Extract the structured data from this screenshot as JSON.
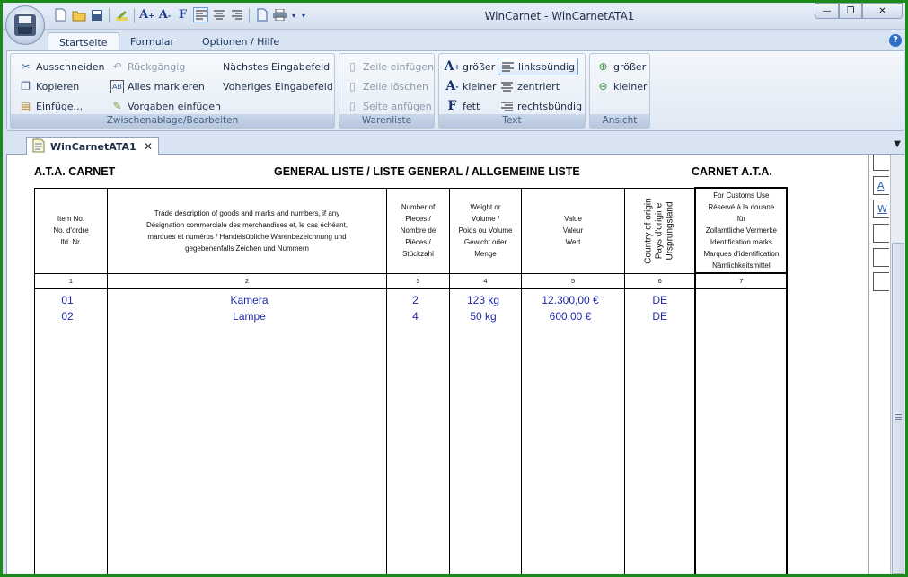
{
  "window": {
    "title": "WinCarnet - WinCarnetATA1",
    "controls": [
      "—",
      "❐",
      "✕"
    ]
  },
  "tabs": [
    "Startseite",
    "Formular",
    "Optionen / Hilfe"
  ],
  "ribbon": {
    "groups": {
      "clipboard": {
        "label": "Zwischenablage/Bearbeiten",
        "cut": "Ausschneiden",
        "copy": "Kopieren",
        "paste": "Einfüge...",
        "undo": "Rückgängig",
        "select_all": "Alles markieren",
        "defaults": "Vorgaben einfügen",
        "next_field": "Nächstes Eingabefeld",
        "prev_field": "Voheriges Eingabefeld"
      },
      "goods": {
        "label": "Warenliste",
        "insert_row": "Zeile einfügen",
        "delete_row": "Zeile löschen",
        "append_page": "Seite anfügen"
      },
      "text": {
        "label": "Text",
        "bigger": "größer",
        "smaller": "kleiner",
        "bold": "fett",
        "left": "linksbündig",
        "center": "zentriert",
        "right": "rechtsbündig"
      },
      "view": {
        "label": "Ansicht",
        "bigger": "größer",
        "smaller": "kleiner"
      }
    }
  },
  "document_tab": {
    "label": "WinCarnetATA1",
    "close": "✕"
  },
  "sheet": {
    "title_left": "A.T.A. CARNET",
    "title_center": "GENERAL LISTE / LISTE GENERAL / ALLGEMEINE LISTE",
    "title_right": "CARNET A.T.A.",
    "headers": {
      "c1": [
        "Item No.",
        "No. d'ordre",
        "lfd. Nr."
      ],
      "c2": [
        "Trade description of goods and marks and numbers, if any",
        "Désignation commerciale des merchandises et, le cas échéant,",
        "marques et numéros / Handelsübliche Warenbezeichnung und",
        "gegebenenfalls Zeichen und Nummern"
      ],
      "c3": [
        "Number of",
        "Pieces /",
        "Nombre de",
        "Pièces /",
        "Stückzahl"
      ],
      "c4": [
        "Weight or",
        "Volume /",
        "Poids ou Volume",
        "Gewicht oder",
        "Menge"
      ],
      "c5": [
        "Value",
        "Valeur",
        "Wert"
      ],
      "c6": [
        "Country of origin",
        "Pays d'origine",
        "Ursprungsland"
      ],
      "c7": [
        "For Customs Use",
        "Réservé à la douane",
        "für",
        "Zollamtliche Vermerke",
        "Identification marks",
        "Marques d'identification",
        "Nämlichkeitsmittel"
      ]
    },
    "col_numbers": [
      "1",
      "2",
      "3",
      "4",
      "5",
      "6",
      "7"
    ],
    "rows": [
      {
        "no": "01",
        "desc": "Kamera",
        "pieces": "2",
        "weight": "123 kg",
        "value": "12.300,00 €",
        "origin": "DE"
      },
      {
        "no": "02",
        "desc": "Lampe",
        "pieces": "4",
        "weight": "50 kg",
        "value": "600,00 €",
        "origin": "DE"
      }
    ]
  },
  "right_panel": {
    "links": [
      "A",
      "W"
    ]
  },
  "colors": {
    "frame": "#1a8a1a",
    "ribbon_bg": "#dfe8f4",
    "data_text": "#1f28a8",
    "selected_button": "#dbe8f8"
  }
}
